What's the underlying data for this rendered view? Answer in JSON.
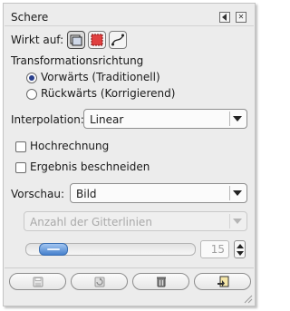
{
  "dialog": {
    "title": "Schere"
  },
  "header": {
    "configure_icon": "tab-menu-icon",
    "close_icon": "close-icon",
    "close_glyph": "✕"
  },
  "affects": {
    "label": "Wirkt auf:",
    "buttons": [
      {
        "icon": "layer-icon",
        "active": true
      },
      {
        "icon": "selection-icon",
        "active": false
      },
      {
        "icon": "path-icon",
        "active": false
      }
    ]
  },
  "direction": {
    "label": "Transformationsrichtung",
    "options": [
      {
        "label": "Vorwärts (Traditionell)",
        "checked": true
      },
      {
        "label": "Rückwärts (Korrigierend)",
        "checked": false
      }
    ]
  },
  "interpolation": {
    "label": "Interpolation:",
    "value": "Linear"
  },
  "supersampling": {
    "label": "Hochrechnung",
    "checked": false
  },
  "clip": {
    "label": "Ergebnis beschneiden",
    "checked": false
  },
  "preview": {
    "label": "Vorschau:",
    "value": "Bild"
  },
  "grid": {
    "type_value": "Anzahl der Gitterlinien",
    "lines_value": "15",
    "slider_fraction": 0.16
  },
  "bottom_buttons": [
    {
      "icon": "save-icon"
    },
    {
      "icon": "restore-icon"
    },
    {
      "icon": "delete-icon"
    },
    {
      "icon": "reset-icon"
    }
  ],
  "colors": {
    "accent": "#4580cc",
    "radio_dot": "#283e8c",
    "selection_red": "#e04040"
  }
}
